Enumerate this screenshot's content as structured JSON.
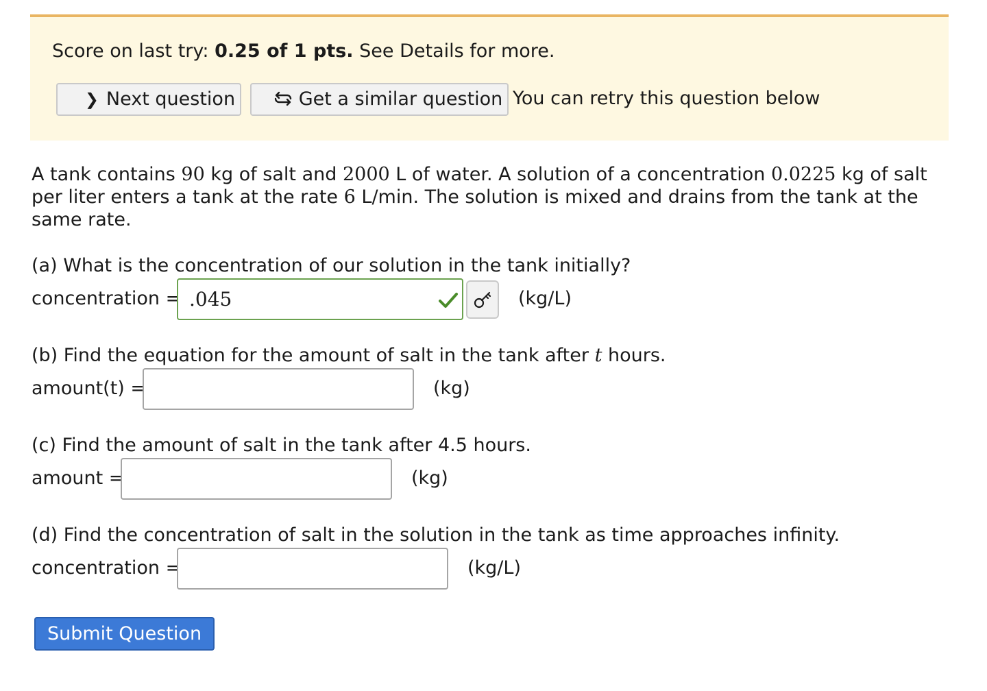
{
  "banner": {
    "score_prefix": "Score on last try: ",
    "score_value": "0.25 of 1 pts.",
    "score_suffix": " See Details for more.",
    "next_label": "Next question",
    "similar_label": "Get a similar question",
    "retry_text": "You can retry this question below"
  },
  "problem": {
    "t1": "A tank contains ",
    "salt_kg": "90",
    "t2": " kg of salt and ",
    "water_l": "2000",
    "t3": " L of water. A solution of a concentration ",
    "conc_in": "0.0225",
    "t4": " kg of salt per liter enters a tank at the rate ",
    "rate": "6",
    "t5": " L/min. The solution is mixed and drains from the tank at the same rate."
  },
  "parts": {
    "a": {
      "question": "(a) What is the concentration of our solution in the tank initially?",
      "label": "concentration =",
      "value": ".045",
      "unit": "(kg/L)",
      "status": "correct"
    },
    "b": {
      "question_pre": "(b) Find the equation for the amount of salt in the tank after ",
      "question_var": "t",
      "question_post": " hours.",
      "label": "amount(t) =",
      "value": "",
      "unit": "(kg)"
    },
    "c": {
      "question": "(c) Find the amount of salt in the tank after 4.5 hours.",
      "label": "amount =",
      "value": "",
      "unit": "(kg)"
    },
    "d": {
      "question": "(d) Find the concentration of salt in the solution in the tank as time approaches infinity.",
      "label": "concentration =",
      "value": "",
      "unit": "(kg/L)"
    }
  },
  "submit_label": "Submit Question",
  "icons": {
    "next": "chevron-right-icon",
    "similar": "refresh-arrows-icon",
    "check": "check-icon",
    "key": "key-icon"
  },
  "colors": {
    "banner_bg": "#fef8e1",
    "banner_border": "#e9b562",
    "correct": "#4a8c2a",
    "submit_bg": "#3c7ad7"
  }
}
